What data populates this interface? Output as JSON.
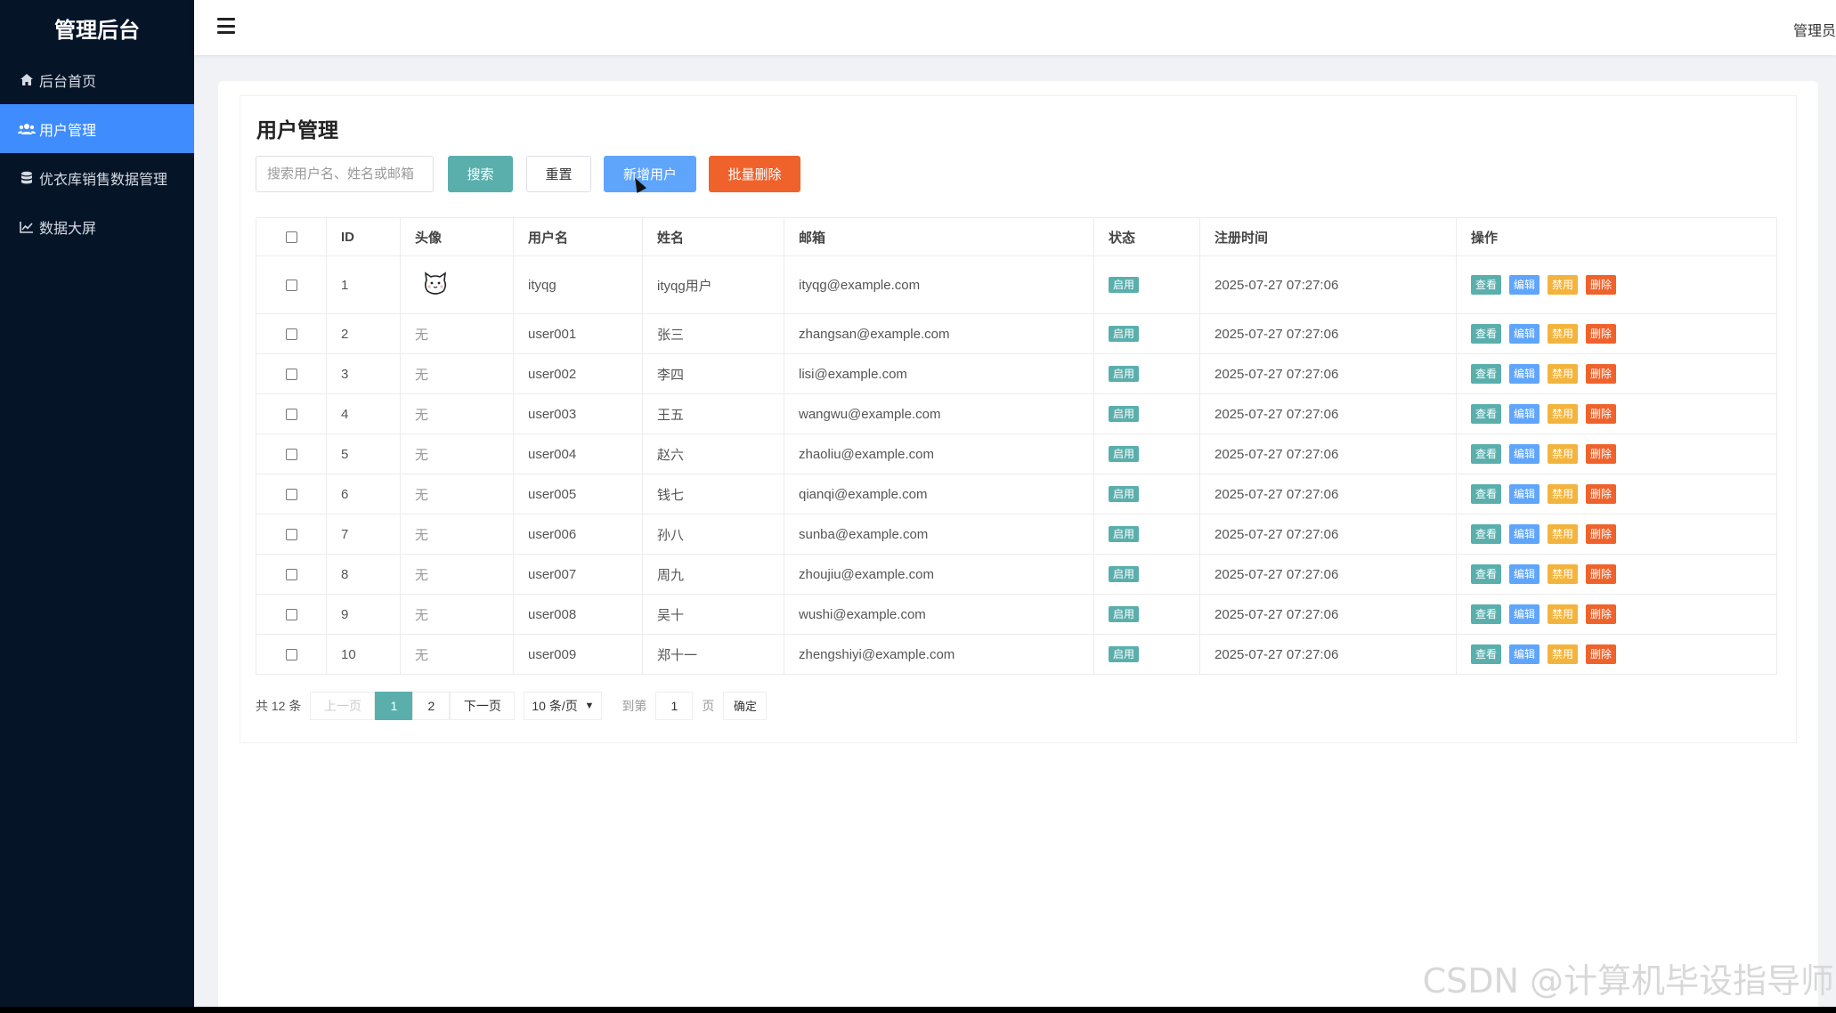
{
  "sidebar": {
    "brand": "管理后台",
    "items": [
      {
        "label": "后台首页",
        "icon": "home-icon"
      },
      {
        "label": "用户管理",
        "icon": "users-icon"
      },
      {
        "label": "优衣库销售数据管理",
        "icon": "database-icon"
      },
      {
        "label": "数据大屏",
        "icon": "line-chart-icon"
      }
    ]
  },
  "header": {
    "user_label": "管理员"
  },
  "main": {
    "title": "用户管理",
    "search_placeholder": "搜索用户名、姓名或邮箱",
    "buttons": {
      "search": "搜索",
      "reset": "重置",
      "add": "新增用户",
      "batch_delete": "批量删除"
    },
    "table": {
      "headers": [
        "ID",
        "头像",
        "用户名",
        "姓名",
        "邮箱",
        "状态",
        "注册时间",
        "操作"
      ],
      "rows": [
        {
          "id": "1",
          "avatar": "",
          "username": "ityqg",
          "name": "ityqg用户",
          "email": "ityqg@example.com",
          "status": "启用",
          "time": "2025-07-27 07:27:06"
        },
        {
          "id": "2",
          "avatar": "无",
          "username": "user001",
          "name": "张三",
          "email": "zhangsan@example.com",
          "status": "启用",
          "time": "2025-07-27 07:27:06"
        },
        {
          "id": "3",
          "avatar": "无",
          "username": "user002",
          "name": "李四",
          "email": "lisi@example.com",
          "status": "启用",
          "time": "2025-07-27 07:27:06"
        },
        {
          "id": "4",
          "avatar": "无",
          "username": "user003",
          "name": "王五",
          "email": "wangwu@example.com",
          "status": "启用",
          "time": "2025-07-27 07:27:06"
        },
        {
          "id": "5",
          "avatar": "无",
          "username": "user004",
          "name": "赵六",
          "email": "zhaoliu@example.com",
          "status": "启用",
          "time": "2025-07-27 07:27:06"
        },
        {
          "id": "6",
          "avatar": "无",
          "username": "user005",
          "name": "钱七",
          "email": "qianqi@example.com",
          "status": "启用",
          "time": "2025-07-27 07:27:06"
        },
        {
          "id": "7",
          "avatar": "无",
          "username": "user006",
          "name": "孙八",
          "email": "sunba@example.com",
          "status": "启用",
          "time": "2025-07-27 07:27:06"
        },
        {
          "id": "8",
          "avatar": "无",
          "username": "user007",
          "name": "周九",
          "email": "zhoujiu@example.com",
          "status": "启用",
          "time": "2025-07-27 07:27:06"
        },
        {
          "id": "9",
          "avatar": "无",
          "username": "user008",
          "name": "吴十",
          "email": "wushi@example.com",
          "status": "启用",
          "time": "2025-07-27 07:27:06"
        },
        {
          "id": "10",
          "avatar": "无",
          "username": "user009",
          "name": "郑十一",
          "email": "zhengshiyi@example.com",
          "status": "启用",
          "time": "2025-07-27 07:27:06"
        }
      ],
      "actions": {
        "view": "查看",
        "edit": "编辑",
        "ban": "禁用",
        "delete": "删除"
      }
    },
    "pagination": {
      "total": "共 12 条",
      "prev": "上一页",
      "pages": [
        "1",
        "2"
      ],
      "current": "1",
      "next": "下一页",
      "page_size": "10 条/页",
      "goto_label": "到第",
      "goto_value": "1",
      "page_unit": "页",
      "confirm": "确定"
    }
  },
  "watermark": "CSDN @计算机毕设指导师",
  "colors": {
    "sidebar_bg": "#051427",
    "active_menu": "#3f8cff",
    "teal": "#5aafad",
    "blue": "#5fa5fc",
    "orange": "#f0622b",
    "yellow": "#f3b43d"
  }
}
